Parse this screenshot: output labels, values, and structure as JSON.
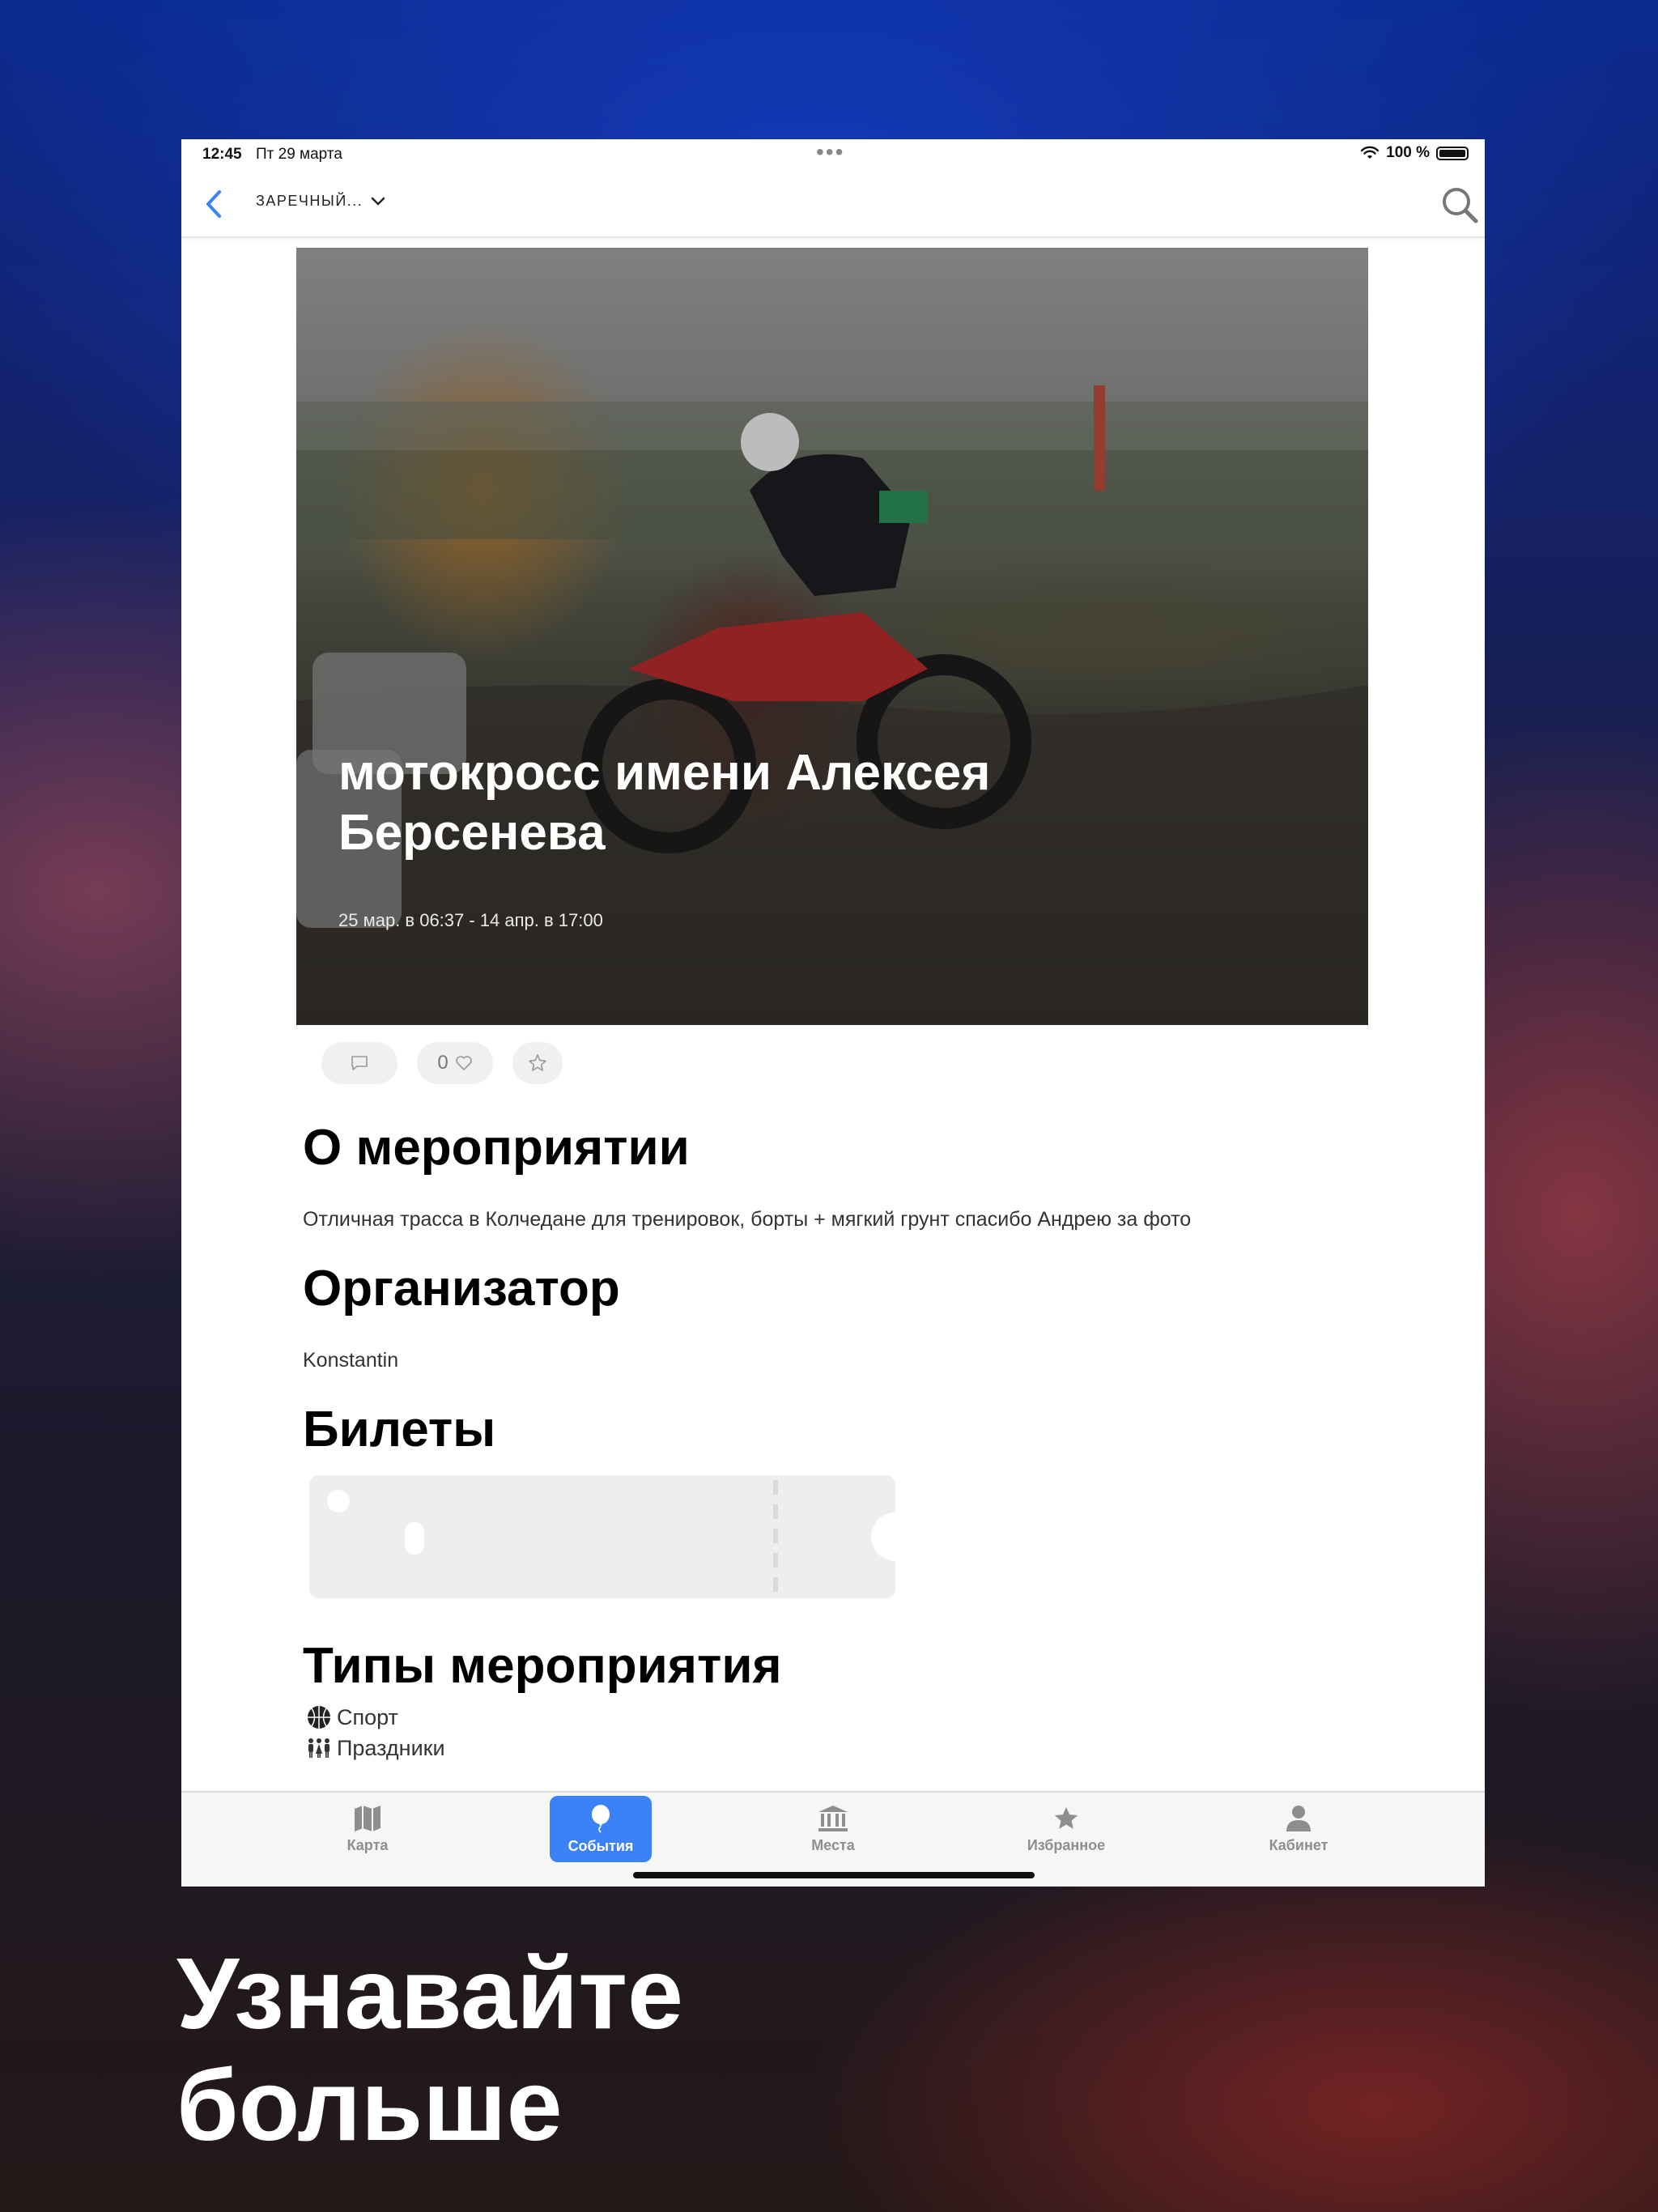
{
  "status_bar": {
    "time": "12:45",
    "date": "Пт 29 марта",
    "dots": "•••",
    "battery_text": "100 %"
  },
  "nav": {
    "city": "ЗАРЕЧНЫЙ...",
    "back_icon": "chevron-left-icon",
    "search_icon": "search-icon",
    "accent_color": "#3b82f6"
  },
  "event": {
    "title": "мотокросс имени Алексея Берсенева",
    "dates": "25 мар. в 06:37 - 14 апр. в 17:00"
  },
  "actions": {
    "likes_count": "0"
  },
  "sections": {
    "about_title": "О мероприятии",
    "about_text": "Отличная трасса в Колчедане для тренировок, борты + мягкий грунт спасибо Андрею за фото",
    "organizer_title": "Организатор",
    "organizer_name": "Konstantin",
    "tickets_title": "Билеты",
    "types_title": "Типы мероприятия"
  },
  "types": [
    {
      "icon": "basketball-icon",
      "label": "Спорт"
    },
    {
      "icon": "people-icon",
      "label": "Праздники"
    }
  ],
  "tabbar": {
    "items": [
      {
        "label": "Карта",
        "icon": "map-icon"
      },
      {
        "label": "События",
        "icon": "balloon-icon",
        "active": true
      },
      {
        "label": "Места",
        "icon": "museum-icon"
      },
      {
        "label": "Избранное",
        "icon": "star-icon"
      },
      {
        "label": "Кабинет",
        "icon": "person-icon"
      }
    ]
  },
  "promo": {
    "line1": "Узнавайте",
    "line2": "больше"
  }
}
